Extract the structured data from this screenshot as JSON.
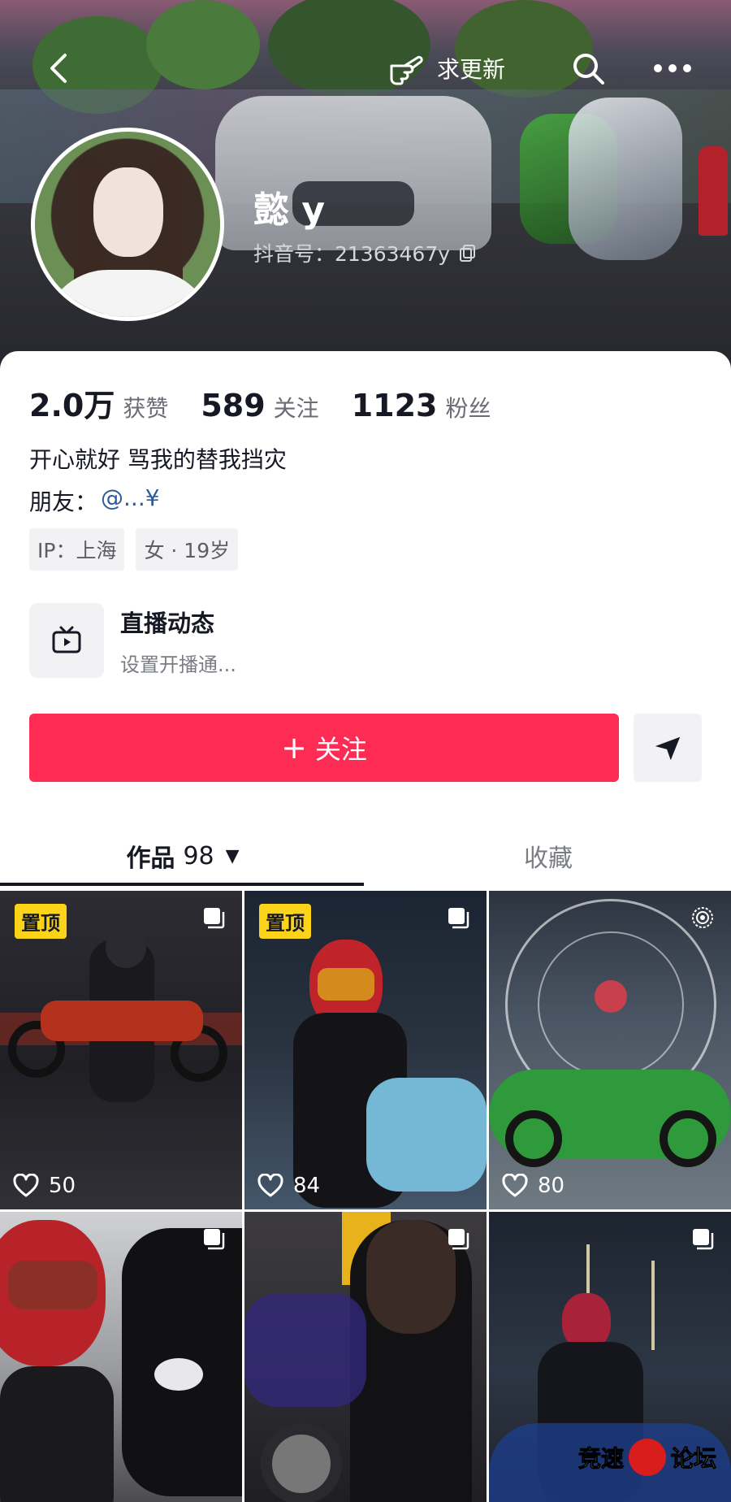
{
  "topbar": {
    "update_label": "求更新"
  },
  "profile": {
    "username": "懿 y",
    "douyin_id": "抖音号：21363467y"
  },
  "stats": [
    {
      "value": "2.0万",
      "label": "获赞"
    },
    {
      "value": "589",
      "label": "关注"
    },
    {
      "value": "1123",
      "label": "粉丝"
    }
  ],
  "bio": "开心就好 骂我的替我挡灾",
  "friends": {
    "label": "朋友：",
    "mention": "@...¥"
  },
  "tags": [
    "IP：上海",
    "女 · 19岁"
  ],
  "live": {
    "title": "直播动态",
    "subtitle": "设置开播通..."
  },
  "follow_button": {
    "plus": "+",
    "label": "关注"
  },
  "tabs": {
    "works_label": "作品",
    "works_count": "98",
    "favorites_label": "收藏"
  },
  "grid": [
    {
      "pinned": true,
      "pin_label": "置顶",
      "likes": "50"
    },
    {
      "pinned": true,
      "pin_label": "置顶",
      "likes": "84"
    },
    {
      "pinned": false,
      "likes": "80"
    },
    {
      "pinned": false,
      "likes": ""
    },
    {
      "pinned": false,
      "likes": ""
    },
    {
      "pinned": false,
      "likes": ""
    }
  ],
  "watermark": {
    "left": "竞速",
    "right": "论坛"
  },
  "colors": {
    "accent": "#fe2c55",
    "pin": "#fbd41a",
    "mention": "#2b5b9c"
  }
}
